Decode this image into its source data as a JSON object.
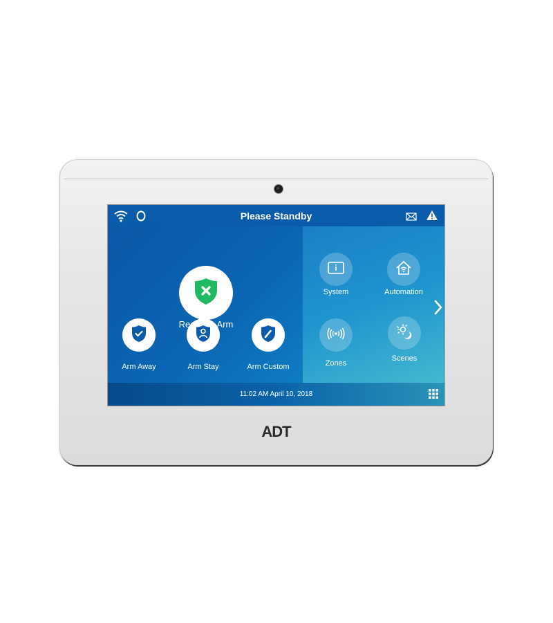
{
  "device": {
    "brand_logo": "ADT"
  },
  "header": {
    "title": "Please Standby",
    "icons": [
      "wifi-icon",
      "alexa-ring-icon",
      "mail-icon",
      "warning-icon"
    ]
  },
  "status": {
    "label": "Ready to Arm",
    "icon": "shield-x-icon",
    "color": "#1fb863"
  },
  "arm_buttons": [
    {
      "label": "Arm Away",
      "icon": "shield-check-icon"
    },
    {
      "label": "Arm Stay",
      "icon": "shield-person-icon"
    },
    {
      "label": "Arm Custom",
      "icon": "shield-pencil-icon"
    }
  ],
  "tiles": [
    {
      "label": "System",
      "icon": "info-panel-icon"
    },
    {
      "label": "Automation",
      "icon": "smart-home-icon"
    },
    {
      "label": "Zones",
      "icon": "wireless-signal-icon"
    },
    {
      "label": "Scenes",
      "icon": "sun-moon-icon"
    }
  ],
  "footer": {
    "datetime": "11:02 AM April 10, 2018",
    "icon": "keypad-grid-icon"
  },
  "colors": {
    "primary": "#0b5bab",
    "accent": "#45b8cf",
    "shield_blue": "#0b5bab"
  }
}
